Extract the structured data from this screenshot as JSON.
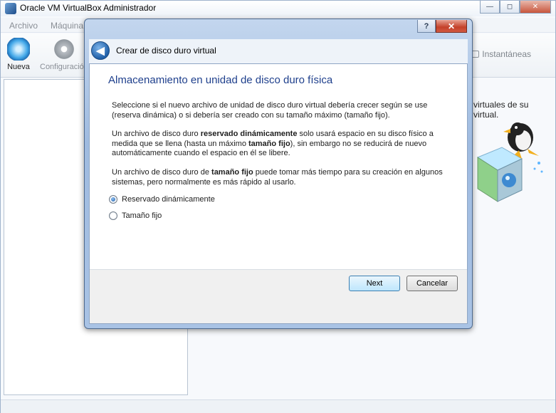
{
  "window": {
    "title": "Oracle VM VirtualBox Administrador",
    "controls": {
      "minimize": "—",
      "maximize": "◻",
      "close": "✕"
    }
  },
  "menu": [
    "Archivo",
    "Máquina"
  ],
  "toolbar": {
    "nueva": "Nueva",
    "configuracion": "Configuración",
    "snapshots_tab": "Instantáneas"
  },
  "welcome": {
    "line1": "virtuales de su",
    "line2": "virtual."
  },
  "dialog": {
    "title": "Crear de disco duro virtual",
    "help": "?",
    "close": "✕",
    "back": "◀",
    "heading": "Almacenamiento en unidad de disco duro física",
    "para1": "Seleccione si el nuevo archivo de unidad de disco duro virtual debería crecer según se use (reserva dinámica) o si debería ser creado con su tamaño máximo (tamaño fijo).",
    "para2": {
      "t1": "Un archivo de disco duro ",
      "b1": "reservado dinámicamente",
      "t2": " solo usará espacio en su disco físico a medida que se llena (hasta un máximo ",
      "b2": "tamaño fijo",
      "t3": "), sin embargo no se reducirá de nuevo automáticamente cuando el espacio en él se libere."
    },
    "para3": {
      "t1": "Un archivo de disco duro de ",
      "b1": "tamaño fijo",
      "t2": " puede tomar más tiempo para su creación en algunos sistemas, pero normalmente es más rápido al usarlo."
    },
    "options": [
      {
        "label": "Reservado dinámicamente",
        "checked": true
      },
      {
        "label": "Tamaño fijo",
        "checked": false
      }
    ],
    "next_label": "Next",
    "cancel_label": "Cancelar"
  },
  "colors": {
    "heading": "#1e3f8c",
    "dialog_frame": "#a9c3e5",
    "primary_button": "#bee6fd"
  }
}
